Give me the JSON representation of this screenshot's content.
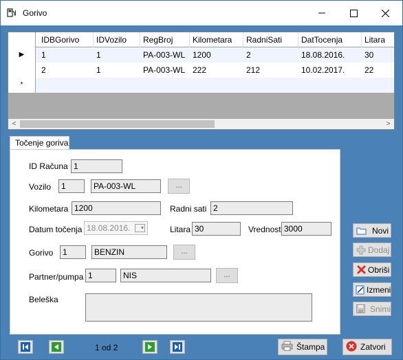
{
  "window": {
    "title": "Gorivo"
  },
  "grid": {
    "columns": [
      "IDBGorivo",
      "IDVozilo",
      "RegBroj",
      "Kilometara",
      "RadniSati",
      "DatTocenja",
      "Litara"
    ],
    "rows": [
      [
        "1",
        "1",
        "PA-003-WL",
        "1200",
        "2",
        "18.08.2016.",
        "30"
      ],
      [
        "2",
        "1",
        "PA-003-WL",
        "222",
        "212",
        "10.02.2017.",
        "22"
      ]
    ],
    "current_row_marker": "▶",
    "new_row_marker": "*"
  },
  "tab": {
    "label": "Točenje goriva"
  },
  "form": {
    "id_racuna_label": "ID Računa",
    "id_racuna_value": "1",
    "vozilo_label": "Vozilo",
    "vozilo_id": "1",
    "vozilo_reg": "PA-003-WL",
    "kilometara_label": "Kilometara",
    "kilometara_value": "1200",
    "radni_sati_label": "Radni sati",
    "radni_sati_value": "2",
    "datum_label": "Datum točenja",
    "datum_value": "18.08.2016.",
    "litara_label": "Litara",
    "litara_value": "30",
    "vrednost_label": "Vrednost",
    "vrednost_value": "3000",
    "gorivo_label": "Gorivo",
    "gorivo_id": "1",
    "gorivo_name": "BENZIN",
    "partner_label": "Partner/pumpa",
    "partner_id": "1",
    "partner_name": "NIS",
    "beleska_label": "Beleška",
    "beleska_value": "",
    "dots": "..."
  },
  "actions": {
    "novi": "Novi",
    "dodaj": "Dodaj",
    "obrisi": "Obriši",
    "izmeni": "Izmeni",
    "snimi": "Snimi"
  },
  "footer": {
    "page_info": "1 od 2",
    "print": "Štampa",
    "close": "Zatvori"
  },
  "colors": {
    "window_bg": "#4a82b8",
    "nav_green": "#2e9b2e",
    "nav_blue": "#1a5fb4",
    "close_red": "#d9302a"
  }
}
